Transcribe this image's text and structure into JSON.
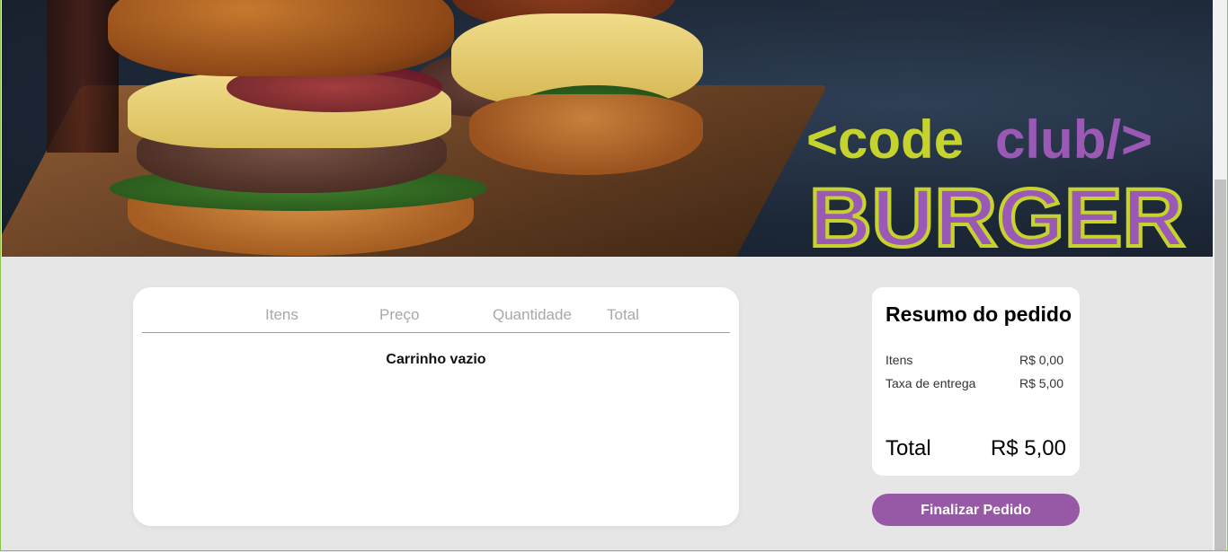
{
  "hero": {
    "logo_line1_part1": "<code",
    "logo_line1_part2": "club/>",
    "logo_line2": "BURGER",
    "colors": {
      "lime": "#c6d32f",
      "purple": "#9b59b6"
    }
  },
  "cart": {
    "headers": [
      "Itens",
      "Preço",
      "Quantidade",
      "Total"
    ],
    "empty_message": "Carrinho vazio"
  },
  "summary": {
    "title": "Resumo do pedido",
    "items_label": "Itens",
    "items_value": "R$ 0,00",
    "delivery_label": "Taxa de entrega",
    "delivery_value": "R$ 5,00",
    "total_label": "Total",
    "total_value": "R$ 5,00"
  },
  "actions": {
    "finish_label": "Finalizar Pedido",
    "finish_color": "#9758a6"
  }
}
